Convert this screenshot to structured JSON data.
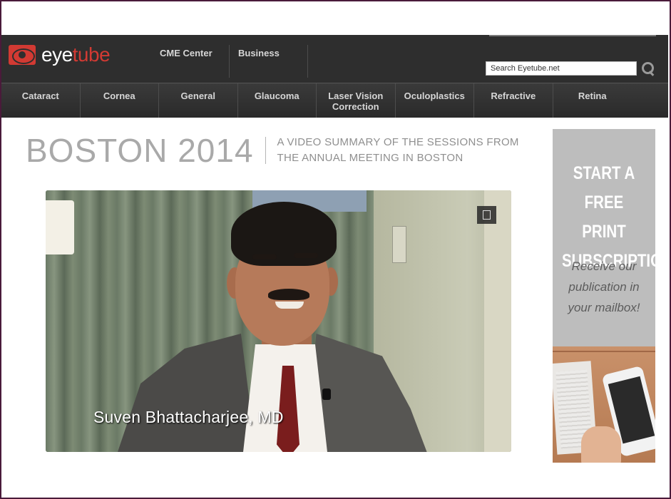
{
  "logo": {
    "part1": "eye",
    "part2": "tube",
    "brand_color": "#d23a33"
  },
  "top_nav": [
    {
      "label": "CME Center"
    },
    {
      "label": "Business"
    }
  ],
  "search": {
    "placeholder": "Search Eyetube.net",
    "icon": "search-icon"
  },
  "categories": [
    {
      "label": "Cataract"
    },
    {
      "label": "Cornea"
    },
    {
      "label": "General"
    },
    {
      "label": "Glaucoma"
    },
    {
      "label": "Laser Vision\nCorrection"
    },
    {
      "label": "Oculoplastics"
    },
    {
      "label": "Refractive"
    },
    {
      "label": "Retina"
    }
  ],
  "headline": {
    "title": "BOSTON 2014",
    "subtitle_line1": "A VIDEO SUMMARY OF THE SESSIONS FROM",
    "subtitle_line2": "THE ANNUAL MEETING IN BOSTON"
  },
  "video": {
    "caption": "Suven Bhattacharjee, MD",
    "expand_icon": "fullscreen-icon"
  },
  "ad": {
    "headline_line1": "START A",
    "headline_line2": "FREE PRINT",
    "headline_line3": "SUBSCRIPTION",
    "sub_line1": "Receive our",
    "sub_line2": "publication in",
    "sub_line3": "your mailbox!"
  }
}
